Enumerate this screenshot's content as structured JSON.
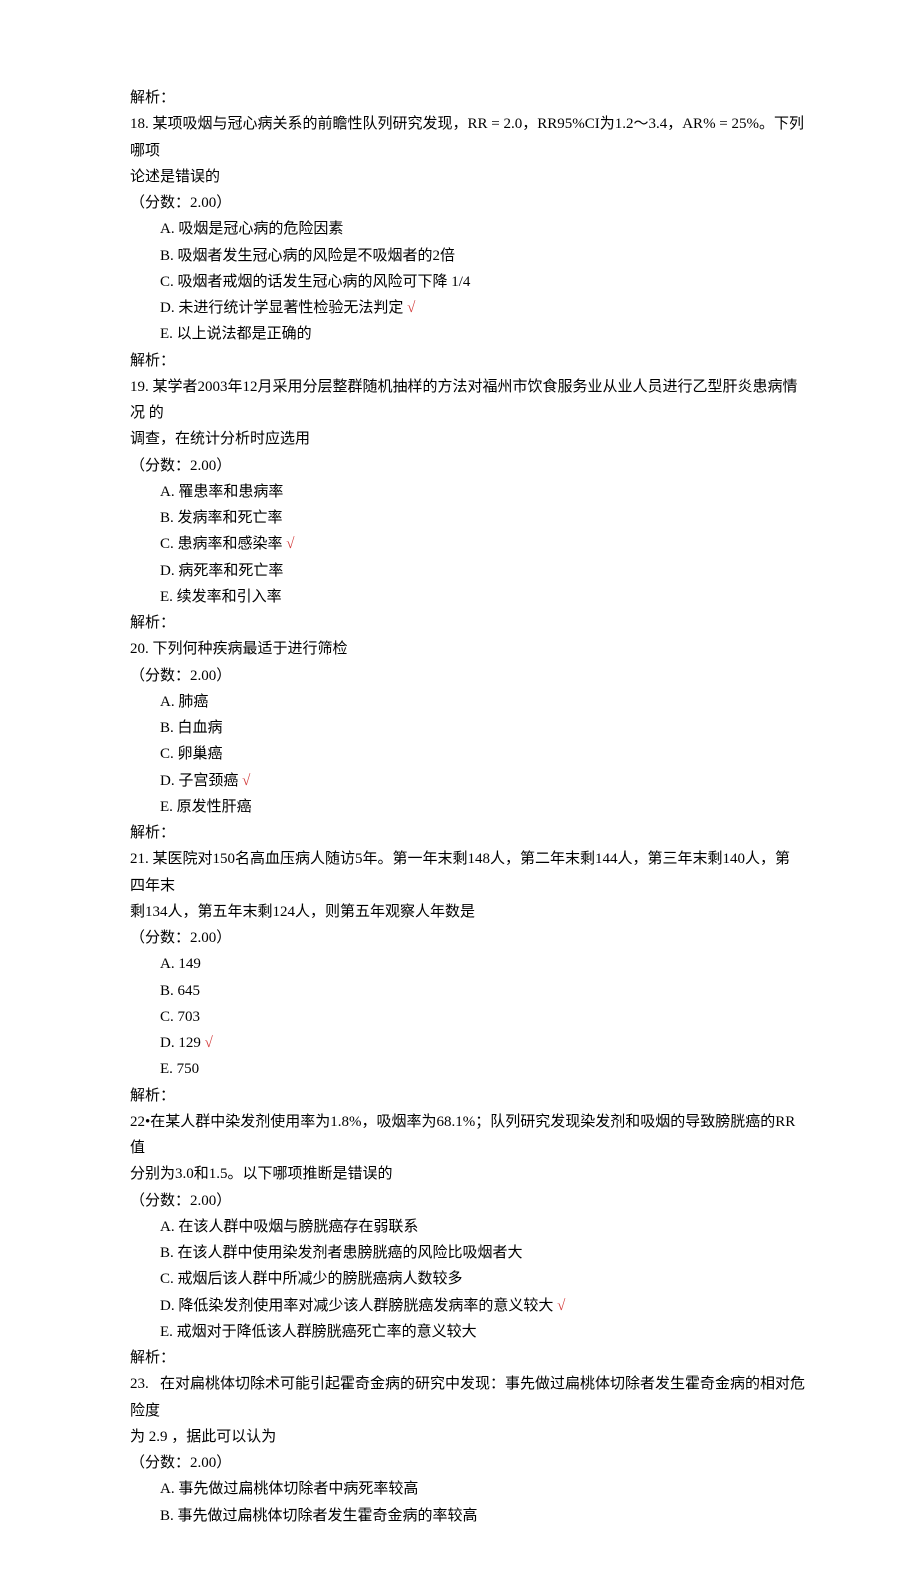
{
  "strings": {
    "jiexi": "解析：",
    "score": "（分数：2.00）"
  },
  "questions": [
    {
      "num": "18",
      "stem_lines": [
        "某项吸烟与冠心病关系的前瞻性队列研究发现，RR = 2.0，RR95%CI为1.2〜3.4，AR% = 25%。下列哪项",
        "论述是错误的"
      ],
      "options": [
        {
          "letter": "A",
          "text": "吸烟是冠心病的危险因素",
          "correct": false
        },
        {
          "letter": "B",
          "text": "吸烟者发生冠心病的风险是不吸烟者的2倍",
          "correct": false
        },
        {
          "letter": "C",
          "text": "吸烟者戒烟的话发生冠心病的风险可下降 1/4",
          "correct": false
        },
        {
          "letter": "D",
          "text": "未进行统计学显著性检验无法判定",
          "correct": true
        },
        {
          "letter": "E",
          "text": "以上说法都是正确的",
          "correct": false
        }
      ]
    },
    {
      "num": "19",
      "stem_lines": [
        "某学者2003年12月采用分层整群随机抽样的方法对福州市饮食服务业从业人员进行乙型肝炎患病情况 的",
        "调查，在统计分析时应选用"
      ],
      "options": [
        {
          "letter": "A",
          "text": "罹患率和患病率",
          "correct": false
        },
        {
          "letter": "B",
          "text": "发病率和死亡率",
          "correct": false
        },
        {
          "letter": "C",
          "text": "患病率和感染率",
          "correct": true
        },
        {
          "letter": "D",
          "text": "病死率和死亡率",
          "correct": false
        },
        {
          "letter": "E",
          "text": "续发率和引入率",
          "correct": false
        }
      ]
    },
    {
      "num": "20",
      "stem_lines": [
        "下列何种疾病最适于进行筛检"
      ],
      "options": [
        {
          "letter": "A",
          "text": "肺癌",
          "correct": false
        },
        {
          "letter": "B",
          "text": "白血病",
          "correct": false
        },
        {
          "letter": "C",
          "text": "卵巢癌",
          "correct": false
        },
        {
          "letter": "D",
          "text": "子宫颈癌",
          "correct": true
        },
        {
          "letter": "E",
          "text": "原发性肝癌",
          "correct": false
        }
      ]
    },
    {
      "num": "21",
      "stem_lines": [
        "某医院对150名高血压病人随访5年。第一年末剩148人，第二年末剩144人，第三年末剩140人，第 四年末",
        "剩134人，第五年末剩124人，则第五年观察人年数是"
      ],
      "options": [
        {
          "letter": "A",
          "text": "149",
          "correct": false
        },
        {
          "letter": "B",
          "text": "645",
          "correct": false
        },
        {
          "letter": "C",
          "text": "703",
          "correct": false
        },
        {
          "letter": "D",
          "text": "129",
          "correct": true
        },
        {
          "letter": "E",
          "text": "750",
          "correct": false
        }
      ]
    },
    {
      "num": "22",
      "sep": "•",
      "stem_lines": [
        "在某人群中染发剂使用率为1.8%，吸烟率为68.1%；队列研究发现染发剂和吸烟的导致膀胱癌的RR值",
        "分别为3.0和1.5。以下哪项推断是错误的"
      ],
      "options": [
        {
          "letter": "A",
          "text": "在该人群中吸烟与膀胱癌存在弱联系",
          "correct": false
        },
        {
          "letter": "B",
          "text": "在该人群中使用染发剂者患膀胱癌的风险比吸烟者大",
          "correct": false
        },
        {
          "letter": "C",
          "text": "戒烟后该人群中所减少的膀胱癌病人数较多",
          "correct": false
        },
        {
          "letter": "D",
          "text": "降低染发剂使用率对减少该人群膀胱癌发病率的意义较大",
          "correct": true
        },
        {
          "letter": "E",
          "text": "戒烟对于降低该人群膀胱癌死亡率的意义较大",
          "correct": false
        }
      ]
    },
    {
      "num": "23",
      "sep": ".   ",
      "stem_lines": [
        "在对扁桃体切除术可能引起霍奇金病的研究中发现：事先做过扁桃体切除者发生霍奇金病的相对危险度",
        "为 2.9 ，据此可以认为"
      ],
      "options": [
        {
          "letter": "A",
          "text": "事先做过扁桃体切除者中病死率较高",
          "correct": false
        },
        {
          "letter": "B",
          "text": "事先做过扁桃体切除者发生霍奇金病的率较高",
          "correct": false
        }
      ],
      "no_trailing_jiexi": true
    }
  ],
  "mark_label": "√"
}
